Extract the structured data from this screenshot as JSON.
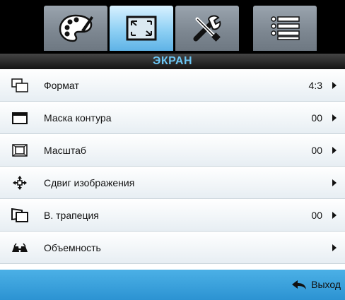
{
  "title": "ЭКРАН",
  "tabs": [
    {
      "icon": "palette-icon",
      "active": false
    },
    {
      "icon": "screen-resize-icon",
      "active": true
    },
    {
      "icon": "tools-icon",
      "active": false
    },
    {
      "icon": "list-menu-icon",
      "active": false
    }
  ],
  "rows": [
    {
      "icon": "format-icon",
      "label": "Формат",
      "value": "4:3"
    },
    {
      "icon": "edge-mask-icon",
      "label": "Маска контура",
      "value": "00"
    },
    {
      "icon": "zoom-icon",
      "label": "Масштаб",
      "value": "00"
    },
    {
      "icon": "image-shift-icon",
      "label": "Сдвиг изображения",
      "value": ""
    },
    {
      "icon": "keystone-icon",
      "label": "В. трапеция",
      "value": "00"
    },
    {
      "icon": "3d-icon",
      "label": "Объемность",
      "value": ""
    }
  ],
  "footer": {
    "exit_label": "Выход",
    "exit_icon": "return-arrow-icon"
  },
  "colors": {
    "title_text": "#6cc6f4",
    "footer": "#3aa3dd",
    "active_tab": "#8ed0f4"
  }
}
